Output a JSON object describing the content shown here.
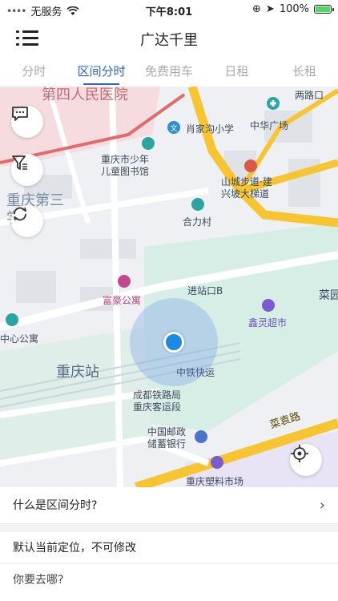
{
  "status_bar": {
    "carrier": "无服务",
    "time": "下午8:01",
    "battery": "100%"
  },
  "header": {
    "title": "广达千里"
  },
  "tabs": [
    {
      "label": "分时",
      "active": false
    },
    {
      "label": "区间分时",
      "active": true
    },
    {
      "label": "免费用车",
      "active": false
    },
    {
      "label": "日租",
      "active": false
    },
    {
      "label": "长租",
      "active": false
    }
  ],
  "map": {
    "labels": {
      "hospital": "第四人民医院",
      "road_top": "两路口",
      "school_primary": "肖家沟小学",
      "zhonghua_square": "中华广场",
      "children_library": "重庆市少年\n儿童图书馆",
      "shancheng": "山城步道·建\n兴坡大梯道",
      "third_school": "重庆第三\n学校",
      "hehe_village": "合力村",
      "entrance_b": "进站口B",
      "caiyuan": "菜园",
      "fuhao": "富豪公寓",
      "xinling": "鑫灵超市",
      "center_apartment": "中心公寓",
      "station": "重庆站",
      "zhongtie": "中铁快运",
      "chengdu_railway": "成都铁路局\n重庆客运段",
      "postal_bank": "中国邮政\n储蓄银行",
      "caiyuan_road": "菜袁路",
      "plastic_market": "重庆塑料市场"
    },
    "accent_color": "#1e88e5"
  },
  "panel": {
    "what_is": "什么是区间分时?",
    "default_location": "默认当前定位，不可修改",
    "where_to": "你要去哪?"
  }
}
